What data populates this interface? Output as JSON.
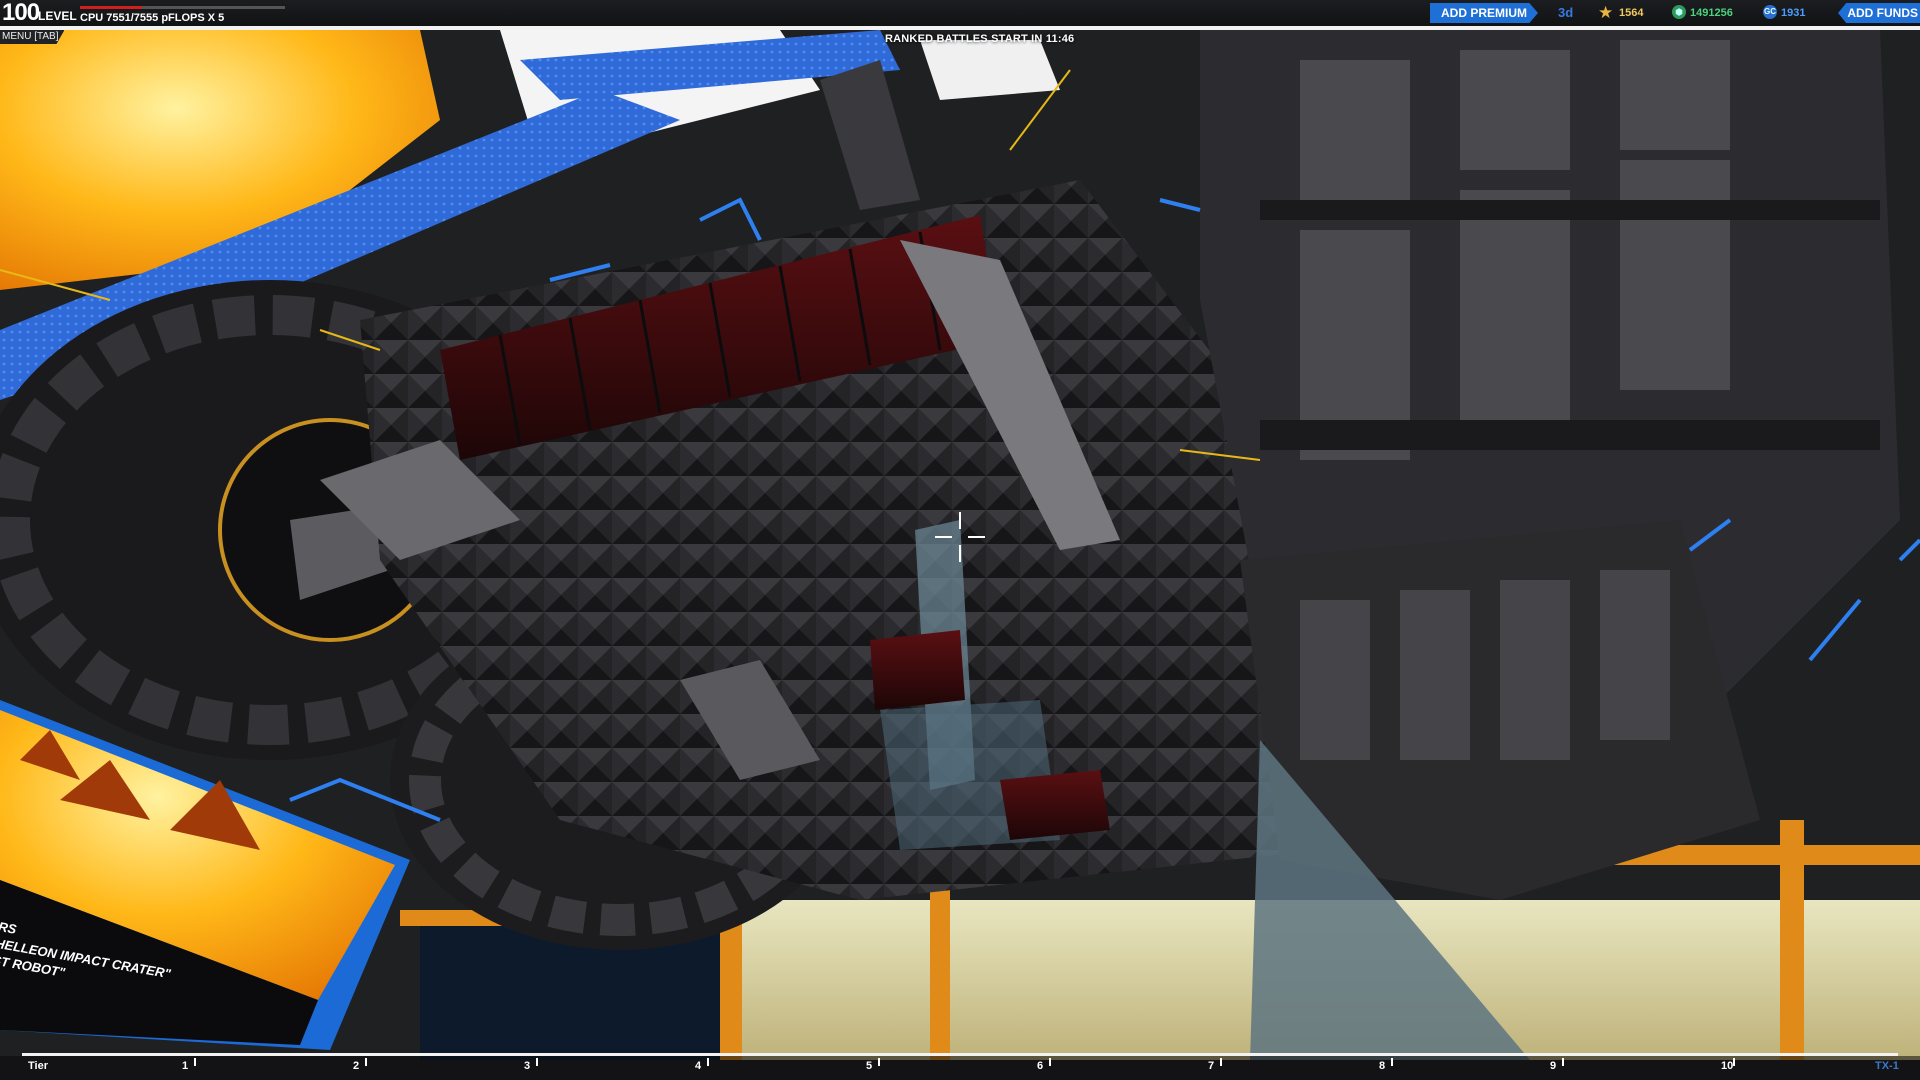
{
  "hud": {
    "level_number": "100",
    "level_label": "LEVEL",
    "level_progress": 0.3,
    "cpu_text": "CPU 7551/7555 pFLOPS X 5",
    "menu_label": "MENU [TAB]",
    "ranked_text": "RANKED BATTLES START IN 11:46",
    "add_premium_label": "ADD PREMIUM",
    "premium_days": "3d",
    "robot_points": "1564",
    "robits": "1491256",
    "galaxy_coins_icon": "GC",
    "galaxy_coins": "1931",
    "add_funds_label": "ADD FUNDS",
    "icons": {
      "star": "star-icon",
      "robits": "robits-icon",
      "gc": "galaxy-coin-icon"
    },
    "colors": {
      "accent_blue": "#1e6fd6",
      "level_bar": "#d01f1f",
      "rp": "#f0c860",
      "robits": "#4cd27c",
      "gc": "#4d9bff"
    }
  },
  "tier_bar": {
    "label": "Tier",
    "tiers": [
      "1",
      "2",
      "3",
      "4",
      "5",
      "6",
      "7",
      "8",
      "9",
      "10"
    ],
    "end_label": "TX-1"
  },
  "screen_text": {
    "line1": "RS",
    "line2": "HELLEON IMPACT CRATER\"",
    "line3": "ST ROBOT\""
  }
}
